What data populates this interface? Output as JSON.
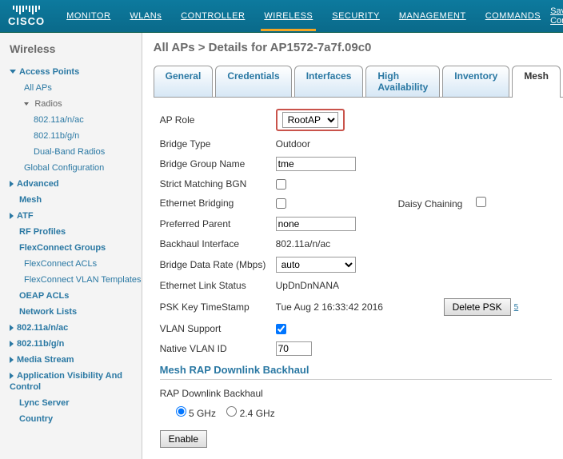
{
  "header": {
    "save_link": "Save Confi",
    "brand": "CISCO",
    "nav": [
      "MONITOR",
      "WLANs",
      "CONTROLLER",
      "WIRELESS",
      "SECURITY",
      "MANAGEMENT",
      "COMMANDS"
    ],
    "nav_active_index": 3
  },
  "sidebar": {
    "title": "Wireless",
    "access_points": "Access Points",
    "all_aps": "All APs",
    "radios": "Radios",
    "radio_an": "802.11a/n/ac",
    "radio_bg": "802.11b/g/n",
    "dual_band": "Dual-Band Radios",
    "global_cfg": "Global Configuration",
    "advanced": "Advanced",
    "mesh": "Mesh",
    "atf": "ATF",
    "rf_profiles": "RF Profiles",
    "flexconnect_groups": "FlexConnect Groups",
    "flexconnect_acls": "FlexConnect ACLs",
    "flexconnect_vlan": "FlexConnect VLAN Templates",
    "oeap_acls": "OEAP ACLs",
    "network_lists": "Network Lists",
    "an": "802.11a/n/ac",
    "bg": "802.11b/g/n",
    "media_stream": "Media Stream",
    "avc": "Application Visibility And Control",
    "lync": "Lync Server",
    "country": "Country"
  },
  "page": {
    "title": "All APs > Details for AP1572-7a7f.09c0",
    "tabs": [
      "General",
      "Credentials",
      "Interfaces",
      "High Availability",
      "Inventory",
      "Mesh"
    ],
    "active_tab_index": 5
  },
  "form": {
    "ap_role_label": "AP Role",
    "ap_role_value": "RootAP",
    "bridge_type_label": "Bridge Type",
    "bridge_type_value": "Outdoor",
    "bgn_label": "Bridge Group Name",
    "bgn_value": "tme",
    "strict_bgn_label": "Strict Matching BGN",
    "eth_bridging_label": "Ethernet Bridging",
    "daisy_chaining_label": "Daisy Chaining",
    "pref_parent_label": "Preferred Parent",
    "pref_parent_value": "none",
    "backhaul_if_label": "Backhaul Interface",
    "backhaul_if_value": "802.11a/n/ac",
    "bridge_rate_label": "Bridge Data Rate (Mbps)",
    "bridge_rate_value": "auto",
    "eth_link_label": "Ethernet Link Status",
    "eth_link_value": "UpDnDnNANA",
    "psk_ts_label": "PSK Key TimeStamp",
    "psk_ts_value": "Tue Aug  2 16:33:42 2016",
    "delete_psk": "Delete PSK",
    "psk_footnote": "5",
    "vlan_support_label": "VLAN Support",
    "native_vlan_label": "Native VLAN ID",
    "native_vlan_value": "70",
    "mesh_section": "Mesh RAP Downlink Backhaul",
    "rap_downlink_label": "RAP Downlink Backhaul",
    "radio_5g": "5 GHz",
    "radio_24g": "2.4 GHz",
    "enable_btn": "Enable"
  }
}
